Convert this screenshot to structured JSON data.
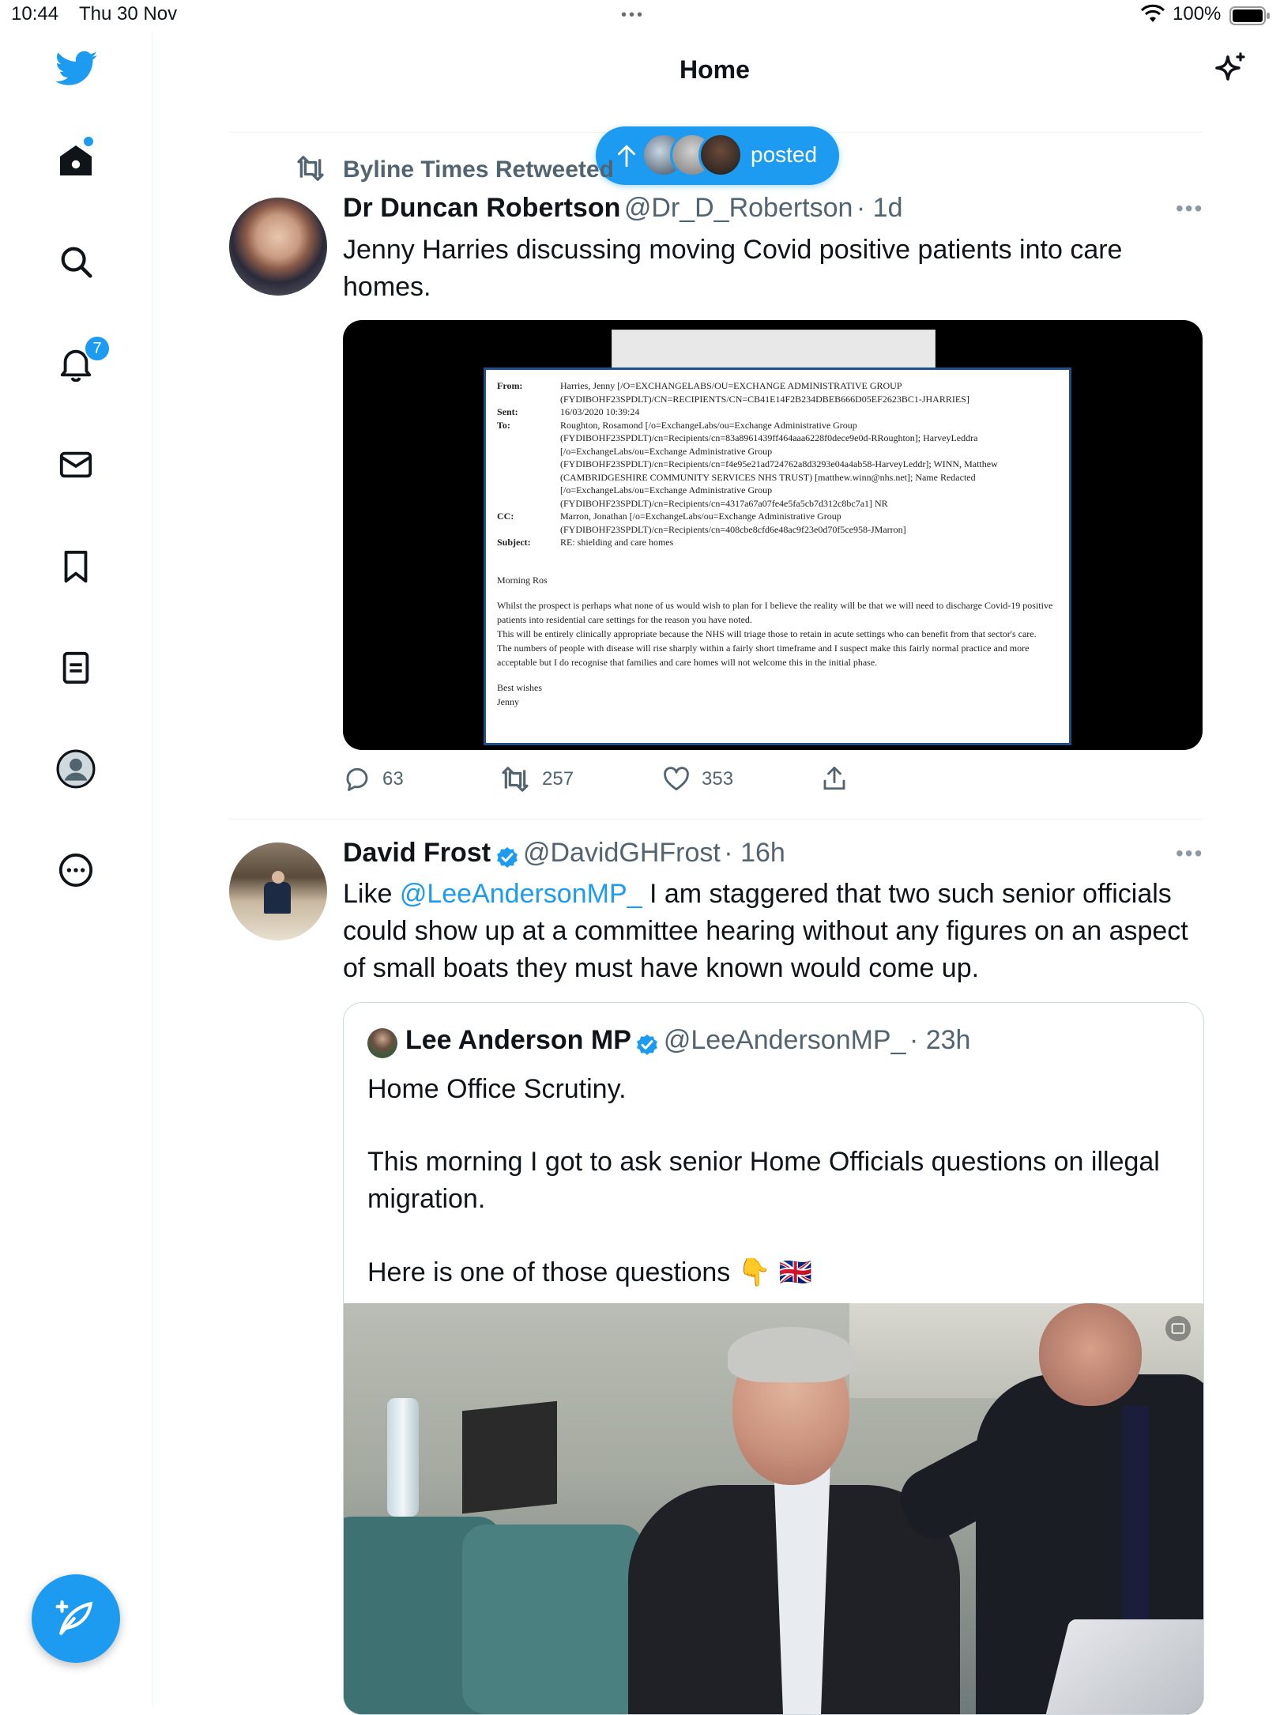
{
  "status_bar": {
    "time": "10:44",
    "date": "Thu 30 Nov",
    "battery": "100%"
  },
  "sidebar": {
    "items": [
      {
        "name": "home",
        "icon": "home-icon",
        "has_dot": true
      },
      {
        "name": "explore",
        "icon": "search-icon"
      },
      {
        "name": "notifications",
        "icon": "bell-icon",
        "badge": "7"
      },
      {
        "name": "messages",
        "icon": "mail-icon"
      },
      {
        "name": "bookmarks",
        "icon": "bookmark-icon"
      },
      {
        "name": "lists",
        "icon": "list-icon"
      },
      {
        "name": "profile",
        "icon": "profile-avatar-icon"
      },
      {
        "name": "more",
        "icon": "more-circle-icon"
      }
    ],
    "compose_icon": "compose-feather-icon"
  },
  "header": {
    "title": "Home"
  },
  "new_posts_pill": {
    "label": "posted"
  },
  "tweets": [
    {
      "social_context": "Byline Times Retweeted",
      "name": "Dr Duncan Robertson",
      "handle": "@Dr_D_Robertson",
      "time": "· 1d",
      "text": "Jenny Harries discussing moving Covid positive patients into care homes.",
      "media": {
        "email": {
          "from_label": "From:",
          "from": "Harries, Jenny [/O=EXCHANGELABS/OU=EXCHANGE ADMINISTRATIVE GROUP",
          "from2": "(FYDIBOHF23SPDLT)/CN=RECIPIENTS/CN=CB41E14F2B234DBEB666D05EF2623BC1-JHARRIES]",
          "sent_label": "Sent:",
          "sent": "16/03/2020 10:39:24",
          "to_label": "To:",
          "to_lines": [
            "Roughton, Rosamond [/o=ExchangeLabs/ou=Exchange Administrative Group",
            "(FYDIBOHF23SPDLT)/cn=Recipients/cn=83a8961439ff464aaa6228f0dece9e0d-RRoughton]; HarveyLeddra",
            "[/o=ExchangeLabs/ou=Exchange Administrative Group",
            "(FYDIBOHF23SPDLT)/cn=Recipients/cn=f4e95e21ad724762a8d3293e04a4ab58-HarveyLeddr]; WINN, Matthew",
            "(CAMBRIDGESHIRE COMMUNITY SERVICES NHS TRUST) [matthew.winn@nhs.net]; Name Redacted",
            "[/o=ExchangeLabs/ou=Exchange Administrative Group",
            "(FYDIBOHF23SPDLT)/cn=Recipients/cn=4317a67a07fe4e5fa5cb7d312c8bc7a1] NR"
          ],
          "cc_label": "CC:",
          "cc_lines": [
            "Marron, Jonathan [/o=ExchangeLabs/ou=Exchange Administrative Group",
            "(FYDIBOHF23SPDLT)/cn=Recipients/cn=408cbe8cfd6e48ac9f23e0d70f5ce958-JMarron]"
          ],
          "subject_label": "Subject:",
          "subject": "RE: shielding and care homes",
          "greeting": "Morning Ros",
          "body": [
            "Whilst the prospect is perhaps what none of us would wish to plan for I believe the reality will be that we will need to discharge Covid-19 positive patients into residential care settings for the reason you have noted.",
            "This will be entirely clinically appropriate because the NHS will triage those to retain in acute settings who can benefit from that sector's care.",
            "The numbers of people with disease will rise sharply within a fairly short timeframe and I suspect make this fairly normal practice and more acceptable but I do recognise that families and care homes will not welcome this in the initial phase."
          ],
          "signoff": "Best wishes",
          "signature": "Jenny"
        }
      },
      "actions": {
        "replies": "63",
        "retweets": "257",
        "likes": "353"
      }
    },
    {
      "name": "David Frost",
      "handle": "@DavidGHFrost",
      "time": "· 16h",
      "text_prefix": "Like ",
      "mention": "@LeeAndersonMP_",
      "text_suffix": "  I am staggered that two such senior officials could show up at a committee hearing without any figures on an aspect of small boats they must have known would come up.",
      "quote": {
        "name": "Lee Anderson MP",
        "handle": "@LeeAndersonMP_",
        "time": "· 23h",
        "line1": "Home Office Scrutiny.",
        "line2": "This morning I got to ask senior Home Officials questions on illegal migration.",
        "line3": "Here is one of those questions 👇 🇬🇧"
      }
    }
  ],
  "colors": {
    "accent": "#1d9bf0",
    "text": "#0f1419",
    "secondary_text": "#536471"
  }
}
